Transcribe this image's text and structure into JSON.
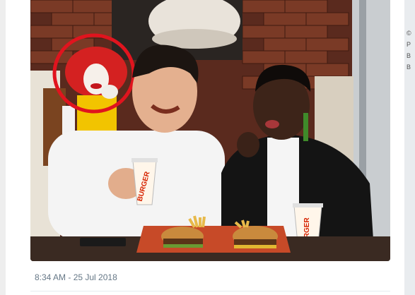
{
  "tweet": {
    "timestamp": "8:34 AM - 25 Jul 2018",
    "photo": {
      "cup_brand_text": "BURGER",
      "annotation_color": "#e0141e"
    }
  },
  "sidebar_snippet": {
    "lines": [
      "©",
      "P",
      "B",
      "B"
    ]
  }
}
